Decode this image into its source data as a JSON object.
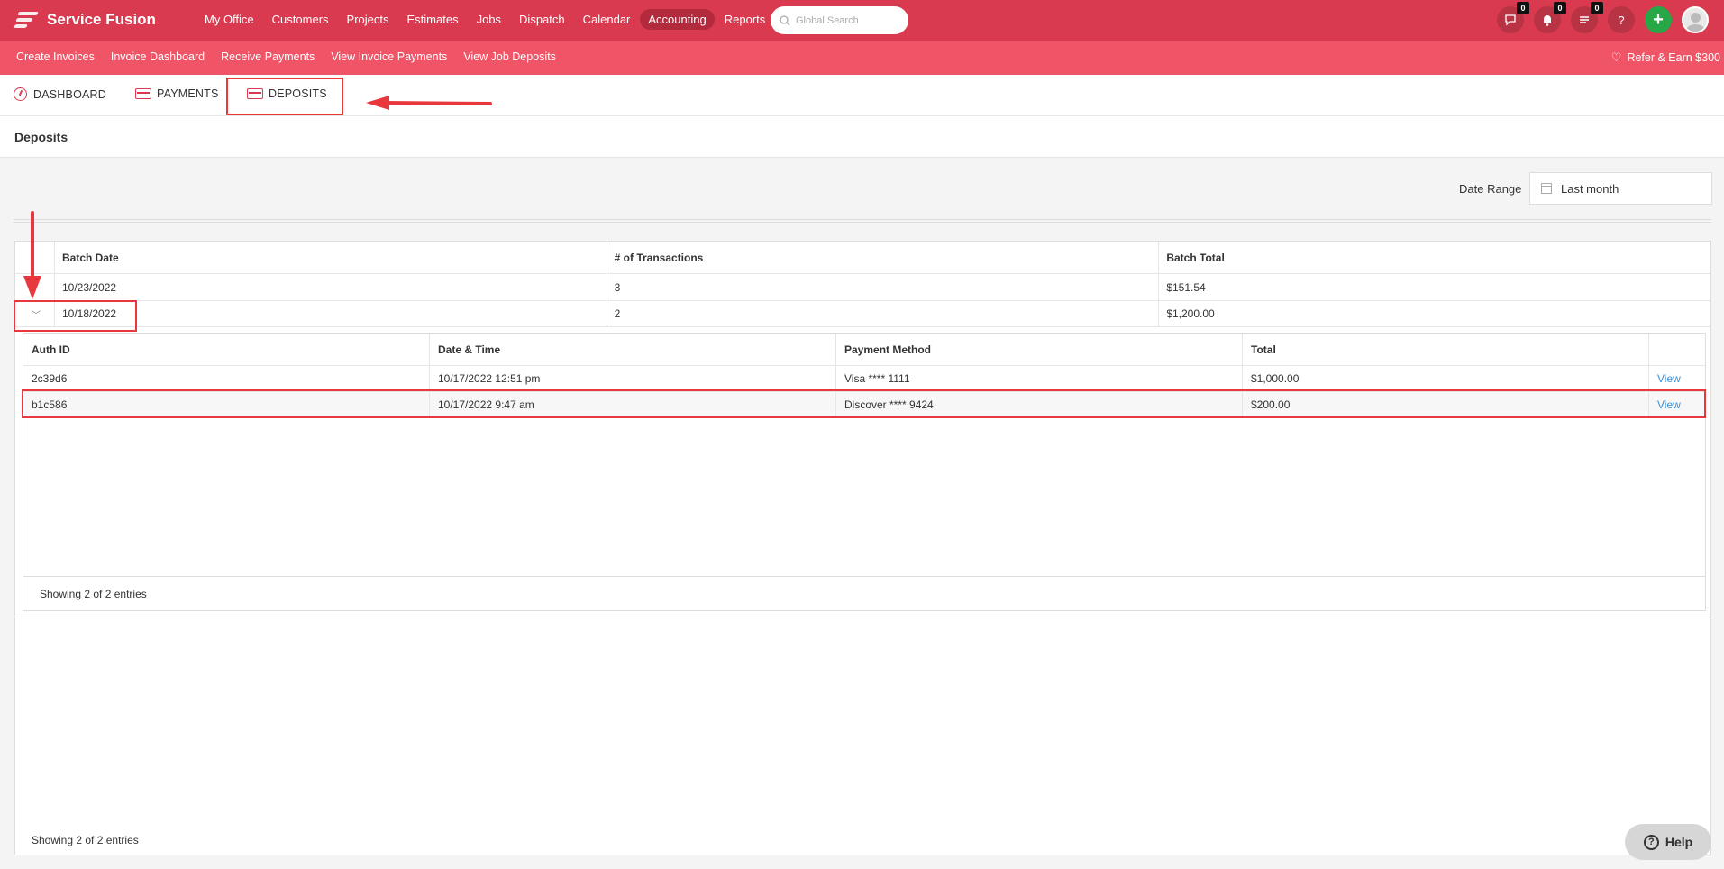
{
  "app": {
    "name": "Service Fusion"
  },
  "nav": {
    "items": [
      "My Office",
      "Customers",
      "Projects",
      "Estimates",
      "Jobs",
      "Dispatch",
      "Calendar",
      "Accounting",
      "Reports"
    ],
    "active": "Accounting"
  },
  "search": {
    "placeholder": "Global Search"
  },
  "top_icons": {
    "chat_count": "0",
    "notifications_count": "0",
    "tasks_count": "0",
    "help_glyph": "?",
    "plus_glyph": "+"
  },
  "subnav": {
    "items": [
      "Create Invoices",
      "Invoice Dashboard",
      "Receive Payments",
      "View Invoice Payments",
      "View Job Deposits"
    ],
    "refer": "Refer & Earn $300"
  },
  "tabs": {
    "dashboard": "DASHBOARD",
    "payments": "PAYMENTS",
    "deposits": "DEPOSITS"
  },
  "page": {
    "title": "Deposits"
  },
  "date_range": {
    "label": "Date Range",
    "value": "Last month"
  },
  "batches": {
    "headers": [
      "Batch Date",
      "# of Transactions",
      "Batch Total"
    ],
    "rows": [
      {
        "date": "10/23/2022",
        "count": "3",
        "total": "$151.54"
      },
      {
        "date": "10/18/2022",
        "count": "2",
        "total": "$1,200.00"
      }
    ],
    "footer": "Showing 2 of 2 entries"
  },
  "transactions": {
    "headers": [
      "Auth ID",
      "Date & Time",
      "Payment Method",
      "Total"
    ],
    "rows": [
      {
        "auth": "2c39d6",
        "datetime": "10/17/2022 12:51 pm",
        "method": "Visa **** 1111",
        "total": "$1,000.00",
        "action": "View"
      },
      {
        "auth": "b1c586",
        "datetime": "10/17/2022 9:47 am",
        "method": "Discover **** 9424",
        "total": "$200.00",
        "action": "View"
      }
    ],
    "footer": "Showing 2 of 2 entries"
  },
  "help": {
    "label": "Help"
  },
  "colors": {
    "topbar": "#d93a4f",
    "subbar": "#ef5567",
    "annotation": "#e8383d",
    "link": "#3a8fd6"
  }
}
